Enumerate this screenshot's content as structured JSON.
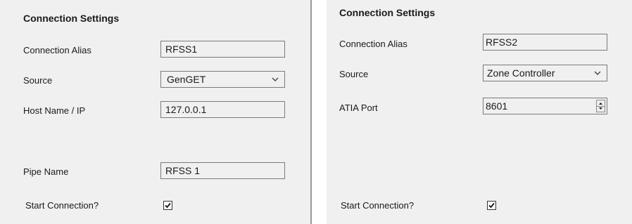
{
  "left_panel": {
    "heading": "Connection Settings",
    "alias_label": "Connection Alias",
    "alias_value": "RFSS1",
    "source_label": "Source",
    "source_value": "GenGET",
    "host_label": "Host Name / IP",
    "host_value": "127.0.0.1",
    "pipe_label": "Pipe Name",
    "pipe_value": "RFSS 1",
    "start_label": "Start Connection?",
    "start_checked": true
  },
  "right_panel": {
    "heading": "Connection Settings",
    "alias_label": "Connection Alias",
    "alias_value": "RFSS2",
    "source_label": "Source",
    "source_value": "Zone Controller",
    "port_label": "ATIA Port",
    "port_value": "8601",
    "start_label": "Start Connection?",
    "start_checked": true
  },
  "icons": {
    "dropdown": "chevron-down-icon",
    "spin": "spin-updown-icon",
    "check": "checkmark-icon"
  }
}
